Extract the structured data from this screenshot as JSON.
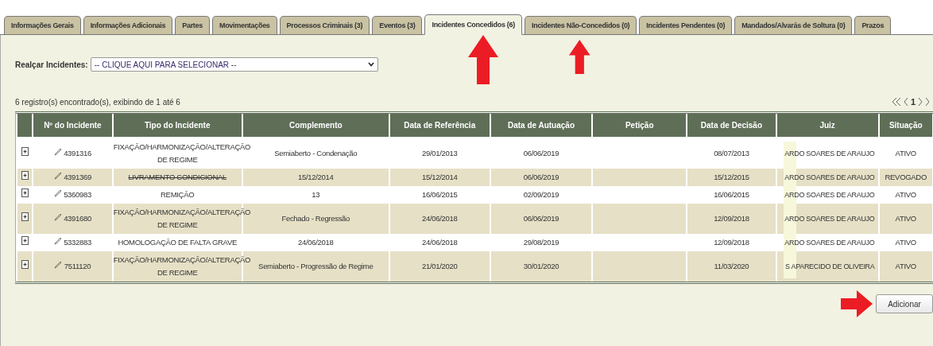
{
  "tabs": [
    {
      "label": "Informações Gerais",
      "selected": false
    },
    {
      "label": "Informações Adicionais",
      "selected": false
    },
    {
      "label": "Partes",
      "selected": false
    },
    {
      "label": "Movimentações",
      "selected": false
    },
    {
      "label": "Processos Criminais (3)",
      "selected": false
    },
    {
      "label": "Eventos (3)",
      "selected": false
    },
    {
      "label": "Incidentes Concedidos (6)",
      "selected": true
    },
    {
      "label": "Incidentes Não-Concedidos (0)",
      "selected": false
    },
    {
      "label": "Incidentes Pendentes (0)",
      "selected": false
    },
    {
      "label": "Mandados/Alvarás de Soltura (0)",
      "selected": false
    },
    {
      "label": "Prazos",
      "selected": false
    }
  ],
  "highlight": {
    "label": "Realçar Incidentes:",
    "value": "-- CLIQUE AQUI PARA SELECIONAR --"
  },
  "records": "6 registro(s) encontrado(s), exibindo de 1 até 6",
  "pager": {
    "page": "1"
  },
  "table": {
    "columns": [
      "Nº do Incidente",
      "Tipo do Incidente",
      "Complemento",
      "Data de Referência",
      "Data de Autuação",
      "Petição",
      "Data de Decisão",
      "Juiz",
      "Situação"
    ],
    "rows": [
      {
        "number": "4391316",
        "type": [
          "FIXAÇÃO/HARMONIZAÇÃO/ALTERAÇÃO",
          "DE REGIME"
        ],
        "struck": false,
        "complement": "Semiaberto - Condenação",
        "ref": "29/01/2013",
        "filed": "06/06/2019",
        "petition": "",
        "decided": "08/07/2013",
        "judge": "ARDO SOARES DE ARAUJO",
        "status": "ATIVO"
      },
      {
        "number": "4391369",
        "type": [
          "LIVRAMENTO CONDICIONAL"
        ],
        "struck": true,
        "complement": "15/12/2014",
        "ref": "15/12/2014",
        "filed": "06/06/2019",
        "petition": "",
        "decided": "15/12/2015",
        "judge": "ARDO SOARES DE ARAUJO",
        "status": "REVOGADO"
      },
      {
        "number": "5360983",
        "type": [
          "REMIÇÃO"
        ],
        "struck": false,
        "complement": "13",
        "ref": "16/06/2015",
        "filed": "02/09/2019",
        "petition": "",
        "decided": "16/06/2015",
        "judge": "ARDO SOARES DE ARAUJO",
        "status": "ATIVO"
      },
      {
        "number": "4391680",
        "type": [
          "FIXAÇÃO/HARMONIZAÇÃO/ALTERAÇÃO",
          "DE REGIME"
        ],
        "struck": false,
        "complement": "Fechado - Regressão",
        "ref": "24/06/2018",
        "filed": "06/06/2019",
        "petition": "",
        "decided": "12/09/2018",
        "judge": "ARDO SOARES DE ARAUJO",
        "status": "ATIVO"
      },
      {
        "number": "5332883",
        "type": [
          "HOMOLOGAÇÃO DE FALTA GRAVE"
        ],
        "struck": false,
        "complement": "24/06/2018",
        "ref": "24/06/2018",
        "filed": "29/08/2019",
        "petition": "",
        "decided": "12/09/2018",
        "judge": "ARDO SOARES DE ARAUJO",
        "status": "ATIVO"
      },
      {
        "number": "7511120",
        "type": [
          "FIXAÇÃO/HARMONIZAÇÃO/ALTERAÇÃO",
          "DE REGIME"
        ],
        "struck": false,
        "complement": "Semiaberto - Progressão de Regime",
        "ref": "21/01/2020",
        "filed": "30/01/2020",
        "petition": "",
        "decided": "11/03/2020",
        "judge": "S APARECIDO DE OLIVEIRA",
        "status": "ATIVO"
      }
    ]
  },
  "add_button": "Adicionar"
}
